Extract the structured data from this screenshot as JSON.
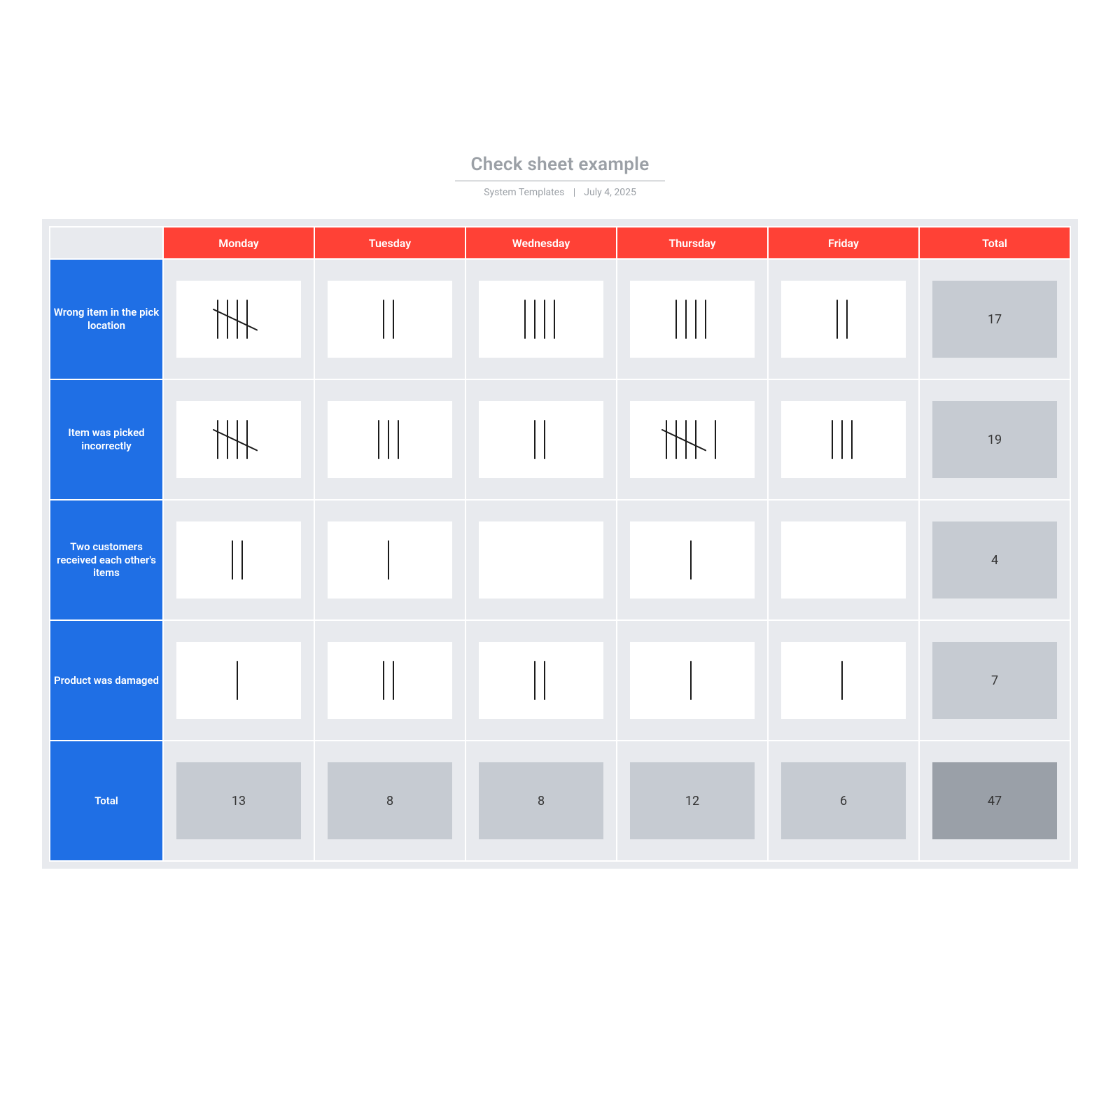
{
  "title": "Check sheet example",
  "author": "System Templates",
  "date": "July 4, 2025",
  "colors": {
    "header_red": "#ff4136",
    "row_blue": "#1f6fe5",
    "panel_grey": "#e8eaee",
    "total_grey": "#c6cbd2",
    "grand_total_grey": "#9aa0a8"
  },
  "columns": [
    "Monday",
    "Tuesday",
    "Wednesday",
    "Thursday",
    "Friday",
    "Total"
  ],
  "chart_data": {
    "type": "table",
    "title": "Check sheet example",
    "columns": [
      "Monday",
      "Tuesday",
      "Wednesday",
      "Thursday",
      "Friday"
    ],
    "rows": [
      {
        "label": "Wrong item in the pick location",
        "values": [
          5,
          2,
          4,
          4,
          2
        ],
        "total": 17
      },
      {
        "label": "Item was picked incorrectly",
        "values": [
          5,
          3,
          2,
          6,
          3
        ],
        "total": 19
      },
      {
        "label": "Two customers received each other's items",
        "values": [
          2,
          1,
          0,
          1,
          0
        ],
        "total": 4
      },
      {
        "label": "Product was damaged",
        "values": [
          1,
          2,
          2,
          1,
          1
        ],
        "total": 7
      }
    ],
    "column_totals": [
      13,
      8,
      8,
      12,
      6
    ],
    "grand_total": 47,
    "total_label": "Total"
  }
}
